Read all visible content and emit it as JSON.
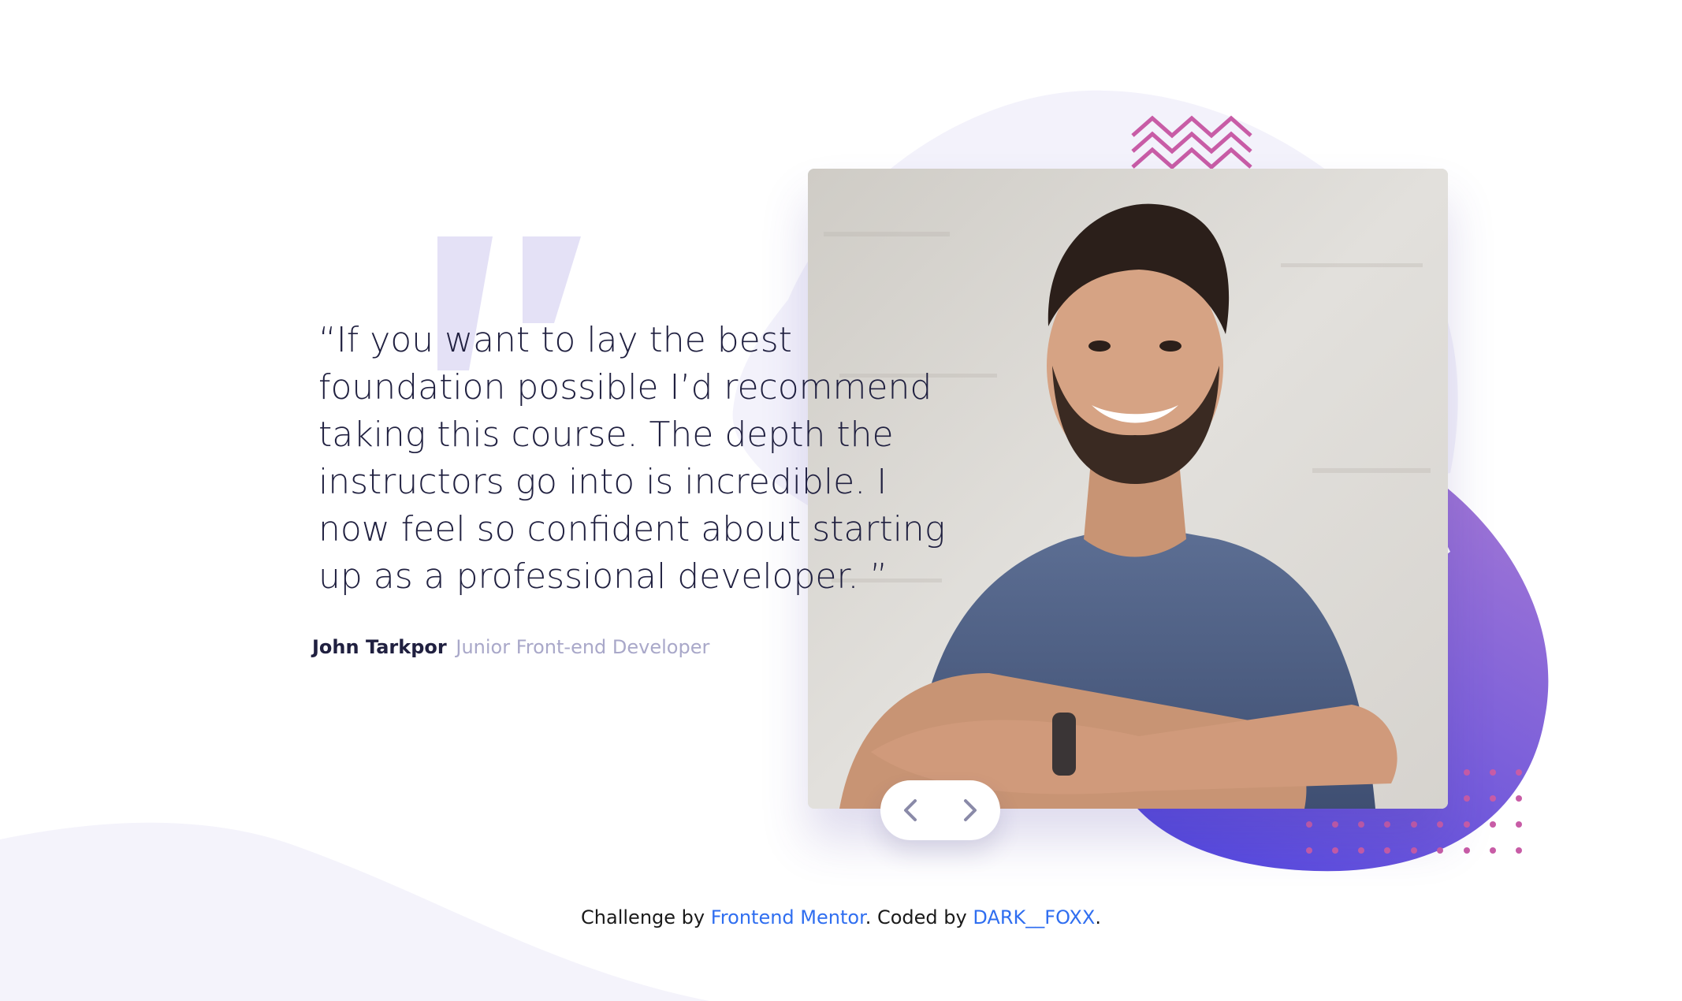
{
  "testimonial": {
    "quote_lines": [
      "“If you want to lay the best",
      "foundation possible I’d recommend",
      "taking this course. The depth the",
      "instructors go into is incredible. I",
      "now feel so confident about starting",
      "up as a professional developer. ”"
    ],
    "author_name": "John Tarkpor",
    "author_role": "Junior Front-end Developer"
  },
  "navigation": {
    "prev_icon": "chevron-left-icon",
    "next_icon": "chevron-right-icon"
  },
  "credit": {
    "prefix": "Challenge by",
    "challenge_link": "Frontend Mentor",
    "middle": ". Coded by",
    "author_link": "DARK__FOXX",
    "suffix": "."
  },
  "colors": {
    "text_dark": "#202040",
    "text_muted": "#a9a8c9",
    "blob_purple": "#6b4fd8",
    "blob_light": "#f3f2fb",
    "accent_pink": "#c85ca6",
    "link_blue": "#2f6ef0"
  }
}
